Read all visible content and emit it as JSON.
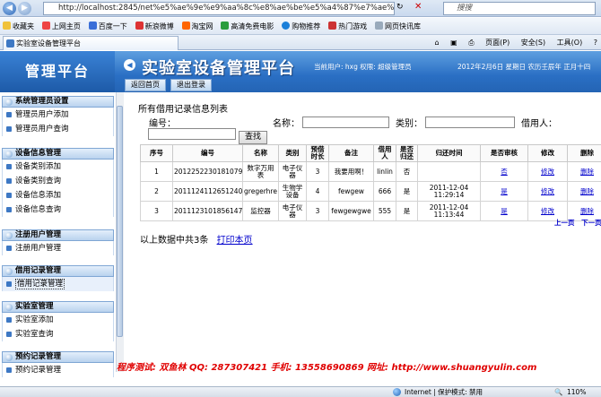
{
  "browser": {
    "url": "http://localhost:2845/net%e5%ae%9e%e9%aa%8c%e8%ae%be%e5%a4%87%e7%ae%a1%e7%90%86%e7%b3%bb%e7%bb%9f/",
    "search_placeholder": "搜搜",
    "favorites_label": "收藏夹",
    "favorites": [
      "上网主页",
      "百度一下",
      "新浪微博",
      "淘宝网",
      "高清免费电影",
      "购物推荐",
      "热门游戏",
      "网页快讯库"
    ],
    "tab_title": "实验室设备管理平台",
    "tools": [
      "页面(P)",
      "安全(S)",
      "工具(O)"
    ]
  },
  "header": {
    "logo": "管理平台",
    "title": "实验室设备管理平台",
    "user_info": "当前用户: hxg  权限: 超级管理员",
    "date_info": "2012年2月6日  星期日  农历壬辰年  正月十四",
    "back_button": "返回首页",
    "logout_button": "退出登录"
  },
  "sidebar": [
    {
      "title": "系统管理员设置",
      "items": [
        "管理员用户添加",
        "管理员用户查询"
      ]
    },
    {
      "title": "设备信息管理",
      "items": [
        "设备类别添加",
        "设备类别查询",
        "设备信息添加",
        "设备信息查询"
      ]
    },
    {
      "title": "注册用户管理",
      "items": [
        "注册用户管理"
      ]
    },
    {
      "title": "借用记录管理",
      "items": [
        "借用记录管理"
      ]
    },
    {
      "title": "实验室管理",
      "items": [
        "实验室添加",
        "实验室查询"
      ]
    },
    {
      "title": "预约记录管理",
      "items": [
        "预约记录管理"
      ]
    }
  ],
  "content": {
    "title": "所有借用记录信息列表",
    "filters": {
      "bianhao": "编号：",
      "mingcheng": "名称：",
      "leibie": "类别：",
      "jieyongren": "借用人："
    },
    "query_button": "查找",
    "columns": [
      "序号",
      "编号",
      "名称",
      "类别",
      "预借时长",
      "备注",
      "借用人",
      "是否归还",
      "归还时间",
      "是否审核",
      "修改",
      "删除"
    ],
    "rows": [
      {
        "seq": "1",
        "code": "2012252230181079",
        "name": "数字万用表",
        "category": "电子仪器",
        "duration": "3",
        "note": "我要用啊！",
        "borrower": "linlin",
        "returned": "否",
        "return_time": "",
        "audited": "否",
        "edit": "修改",
        "delete": "删除"
      },
      {
        "seq": "2",
        "code": "20111241126512408",
        "name": "gregerhre",
        "category": "生物学设备",
        "duration": "4",
        "note": "fewgew",
        "borrower": "666",
        "returned": "是",
        "return_time": "2011-12-04 11:29:14",
        "audited": "是",
        "edit": "修改",
        "delete": "删除"
      },
      {
        "seq": "3",
        "code": "20111231018561478",
        "name": "监控器",
        "category": "电子仪器",
        "duration": "3",
        "note": "fewgewgwe",
        "borrower": "555",
        "returned": "是",
        "return_time": "2011-12-04 11:13:44",
        "audited": "是",
        "edit": "修改",
        "delete": "删除"
      }
    ],
    "pager": {
      "prev": "上一页",
      "next": "下一页"
    },
    "summary": "以上数据中共3条",
    "print_link": "打印本页"
  },
  "footer": "程序测试: 双鱼林    QQ: 287307421    手机: 13558690869    网址: http://www.shuangyulin.com",
  "status": {
    "zone": "Internet | 保护模式: 禁用",
    "zoom": "110%"
  },
  "colors": {
    "header_blue": "#2a6fc4",
    "footer_red": "#e00000",
    "link_blue": "#0000cc"
  }
}
